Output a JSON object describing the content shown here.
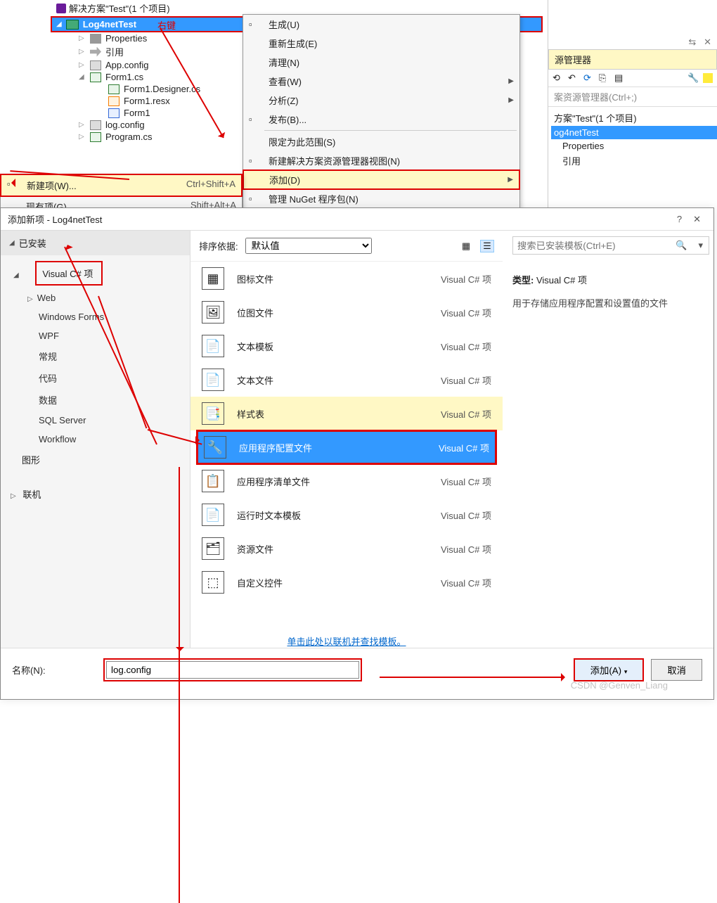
{
  "solution": {
    "header": "解决方案\"Test\"(1 个项目)",
    "project": "Log4netTest",
    "right_click_label": "右键",
    "items": [
      {
        "label": "Properties",
        "icon": "wrench"
      },
      {
        "label": "引用",
        "icon": "ref"
      },
      {
        "label": "App.config",
        "icon": "cfg"
      },
      {
        "label": "Form1.cs",
        "icon": "cs",
        "expanded": true
      },
      {
        "label": "Form1.Designer.cs",
        "icon": "cs",
        "child": true
      },
      {
        "label": "Form1.resx",
        "icon": "resx",
        "child": true
      },
      {
        "label": "Form1",
        "icon": "form",
        "child": true
      },
      {
        "label": "log.config",
        "icon": "cfg"
      },
      {
        "label": "Program.cs",
        "icon": "cs"
      }
    ]
  },
  "context_menu": {
    "items": [
      {
        "label": "生成(U)",
        "icon": "build"
      },
      {
        "label": "重新生成(E)"
      },
      {
        "label": "清理(N)"
      },
      {
        "label": "查看(W)",
        "arrow": true
      },
      {
        "label": "分析(Z)",
        "arrow": true
      },
      {
        "label": "发布(B)...",
        "icon": "publish"
      },
      {
        "sep": true
      },
      {
        "label": "限定为此范围(S)"
      },
      {
        "label": "新建解决方案资源管理器视图(N)",
        "icon": "newview"
      },
      {
        "label": "添加(D)",
        "arrow": true,
        "highlight": true
      },
      {
        "label": "管理 NuGet 程序包(N)",
        "icon": "nuget"
      }
    ]
  },
  "submenu": {
    "items": [
      {
        "label": "新建项(W)...",
        "shortcut": "Ctrl+Shift+A",
        "highlight": true,
        "icon": "newitem"
      },
      {
        "label": "现有项(G)...",
        "shortcut": "Shift+Alt+A"
      }
    ]
  },
  "right_panel": {
    "tab": "源管理器",
    "search_placeholder": "案资源管理器(Ctrl+;)",
    "tree": {
      "line1": "方案\"Test\"(1 个项目)",
      "selected": "og4netTest",
      "sub1": "Properties",
      "sub2": "引用"
    },
    "pin_icons": "⇆ ⤢"
  },
  "dialog": {
    "title": "添加新项 - Log4netTest",
    "tabs": {
      "installed": "已安装",
      "online": "联机"
    },
    "categories": {
      "root": "Visual C# 项",
      "subs": [
        "Web",
        "Windows Forms",
        "WPF",
        "常规",
        "代码",
        "数据",
        "SQL Server",
        "Workflow"
      ],
      "other": "图形"
    },
    "sort_label": "排序依据:",
    "sort_value": "默认值",
    "search_placeholder": "搜索已安装模板(Ctrl+E)",
    "templates": [
      {
        "name": "图标文件",
        "type": "Visual C# 项",
        "icon": "icon-file"
      },
      {
        "name": "位图文件",
        "type": "Visual C# 项",
        "icon": "bitmap"
      },
      {
        "name": "文本模板",
        "type": "Visual C# 项",
        "icon": "text-tmpl"
      },
      {
        "name": "文本文件",
        "type": "Visual C# 项",
        "icon": "text-file"
      },
      {
        "name": "样式表",
        "type": "Visual C# 项",
        "icon": "stylesheet",
        "hover": true
      },
      {
        "name": "应用程序配置文件",
        "type": "Visual C# 项",
        "icon": "app-config",
        "selected": true
      },
      {
        "name": "应用程序清单文件",
        "type": "Visual C# 项",
        "icon": "manifest"
      },
      {
        "name": "运行时文本模板",
        "type": "Visual C# 项",
        "icon": "runtime-tmpl"
      },
      {
        "name": "资源文件",
        "type": "Visual C# 项",
        "icon": "resource"
      },
      {
        "name": "自定义控件",
        "type": "Visual C# 项",
        "icon": "custom-ctrl"
      }
    ],
    "find_online": "单击此处以联机并查找模板。",
    "desc_title": "类型:",
    "desc_type": "Visual C# 项",
    "desc_body": "用于存储应用程序配置和设置值的文件",
    "name_label": "名称(N):",
    "name_value": "log.config",
    "add_btn": "添加(A)",
    "cancel_btn": "取消"
  },
  "watermark": "CSDN @Genven_Liang"
}
